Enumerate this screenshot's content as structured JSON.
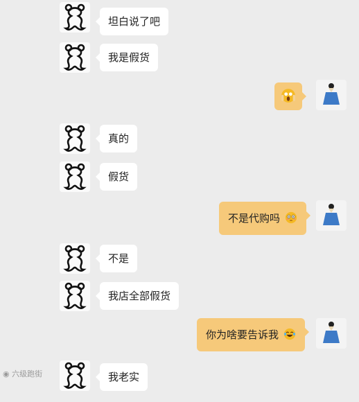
{
  "messages": [
    {
      "side": "left",
      "text": "坦白说了吧"
    },
    {
      "side": "left",
      "text": "我是假货"
    },
    {
      "side": "right",
      "text": "",
      "emoji": "scream-emoji"
    },
    {
      "side": "left",
      "text": "真的"
    },
    {
      "side": "left",
      "text": "假货"
    },
    {
      "side": "right",
      "text": "不是代购吗",
      "emoji": "flushed-emoji"
    },
    {
      "side": "left",
      "text": "不是"
    },
    {
      "side": "left",
      "text": "我店全部假货"
    },
    {
      "side": "right",
      "text": "你为啥要告诉我",
      "emoji": "laugh-cry-emoji"
    },
    {
      "side": "left",
      "text": "我老实"
    }
  ],
  "watermark": {
    "text": "六级跑街"
  },
  "colors": {
    "background": "#ececec",
    "left_bubble": "#ffffff",
    "right_bubble": "#f6c97a"
  }
}
